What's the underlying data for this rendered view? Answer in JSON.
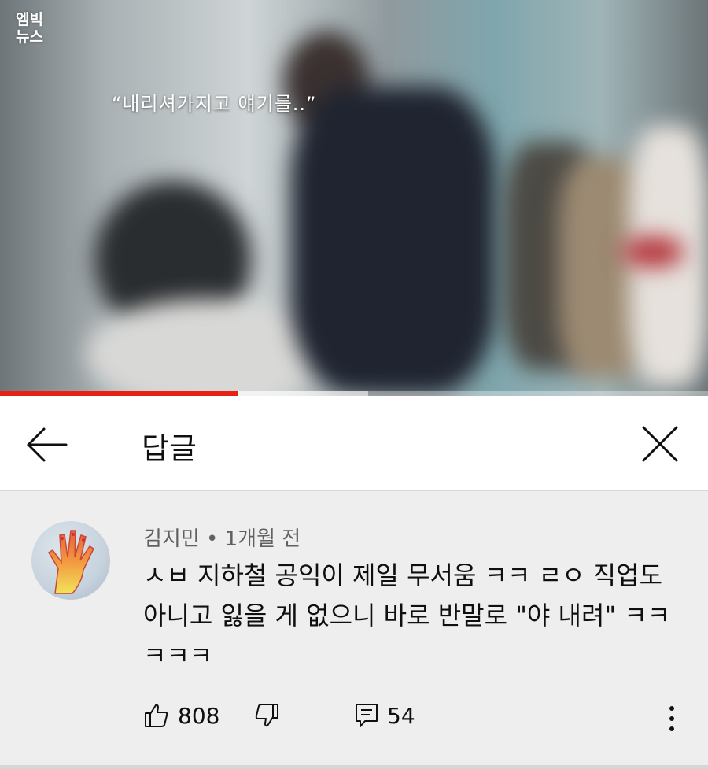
{
  "video": {
    "watermark": "엠빅\n뉴스",
    "subtitle": "“내리셔가지고  얘기를..”",
    "progress": 0.336,
    "buffered": 0.52
  },
  "header": {
    "title": "답글",
    "back_icon": "arrow-left-icon",
    "close_icon": "close-icon"
  },
  "comment": {
    "author": "김지민",
    "separator": "•",
    "time": "1개월 전",
    "text": "ㅅㅂ 지하철 공익이 제일 무서움 ㅋㅋ ㄹㅇ 직업도 아니고 잃을 게 없으니 바로 반말로 \"야 내려\" ㅋㅋㅋㅋㅋ",
    "likes": "808",
    "replies": "54"
  },
  "colors": {
    "progress_red": "#e62117",
    "text_primary": "#0f0f0f",
    "text_secondary": "#606060",
    "comment_bg": "#eeeeee"
  }
}
